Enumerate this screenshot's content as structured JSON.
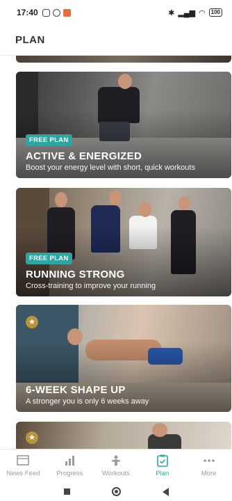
{
  "status": {
    "time": "17:40",
    "battery": "100"
  },
  "header": {
    "title": "PLAN"
  },
  "plans": [
    {
      "badge": "FREE PLAN",
      "title": "ACTIVE & ENERGIZED",
      "subtitle": "Boost your energy level with short, quick workouts",
      "starred": false
    },
    {
      "badge": "FREE PLAN",
      "title": "RUNNING STRONG",
      "subtitle": "Cross-training to improve your running",
      "starred": false
    },
    {
      "badge": "",
      "title": "6-WEEK SHAPE UP",
      "subtitle": "A stronger you is only 6 weeks away",
      "starred": true
    },
    {
      "badge": "",
      "title": "",
      "subtitle": "",
      "starred": true
    }
  ],
  "tabs": [
    {
      "label": "News Feed",
      "icon": "news-feed-icon"
    },
    {
      "label": "Progress",
      "icon": "progress-icon"
    },
    {
      "label": "Workouts",
      "icon": "workouts-icon"
    },
    {
      "label": "Plan",
      "icon": "plan-icon",
      "active": true
    },
    {
      "label": "More",
      "icon": "more-icon"
    }
  ],
  "colors": {
    "accent": "#2aa7a3",
    "star_badge": "#b8953c",
    "tab_inactive": "#9a9a9a"
  }
}
